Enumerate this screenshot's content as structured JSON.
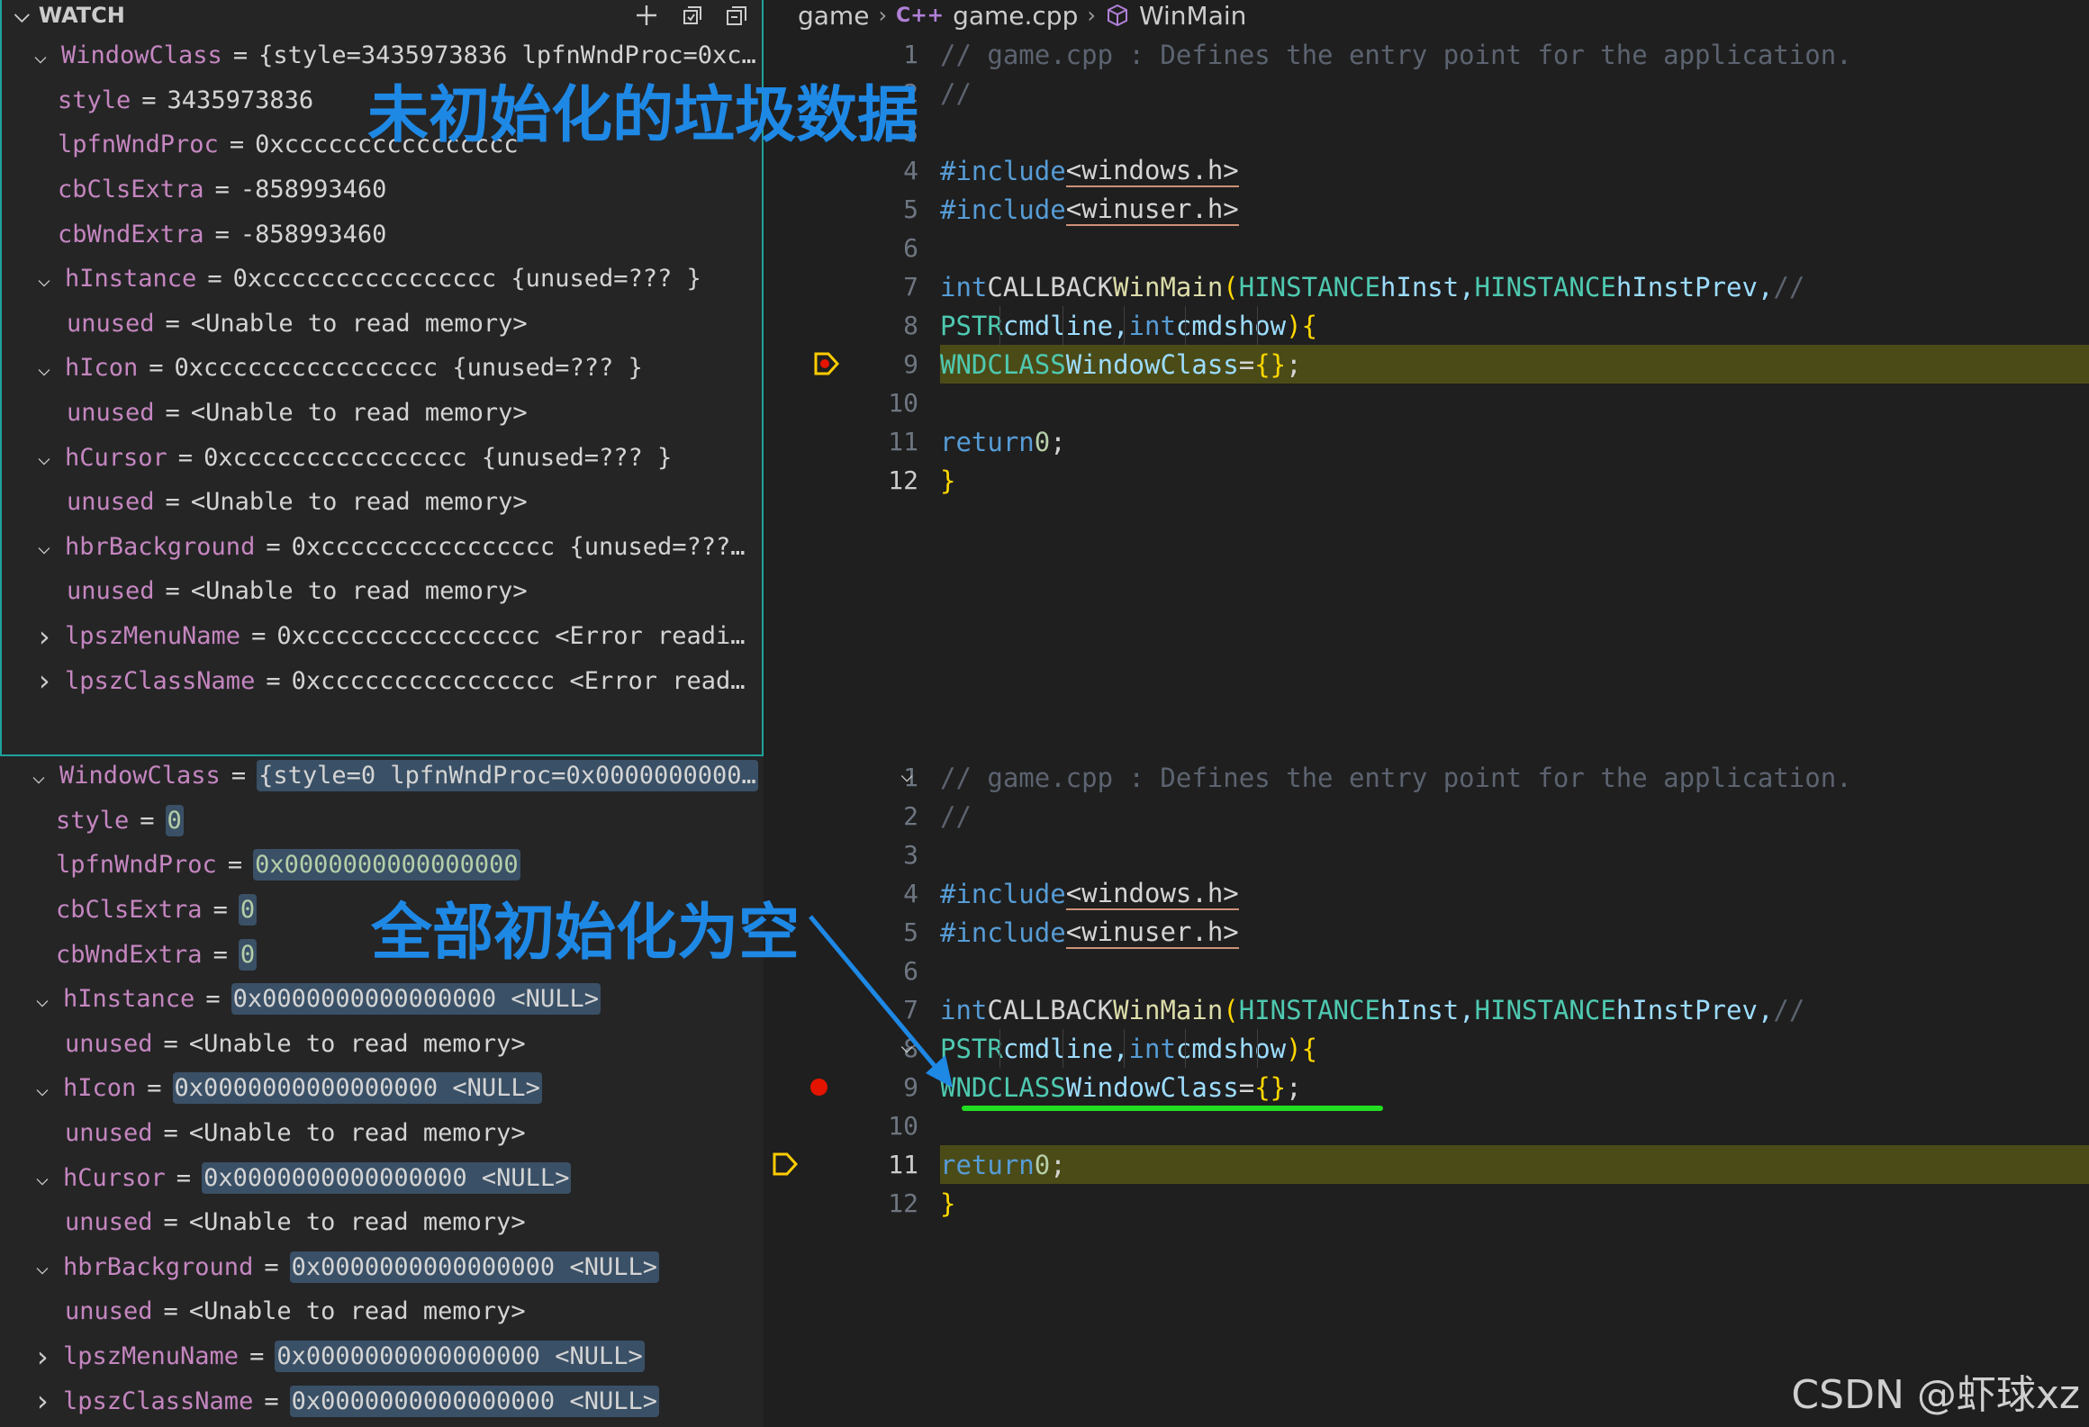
{
  "watch_header": {
    "title": "WATCH"
  },
  "breadcrumb": {
    "folder": "game",
    "lang_icon": "C++",
    "file": "game.cpp",
    "symbol": "WinMain"
  },
  "top": {
    "annotation": "未初始化的垃圾数据",
    "watch_rows": [
      {
        "twisty": "expanded",
        "name": "WindowClass",
        "value": "{style=3435973836 lpfnWndProc=0xc…",
        "value_kind": "text",
        "highlight": false
      },
      {
        "twisty": "none",
        "name": "style",
        "value": "3435973836",
        "value_kind": "text",
        "highlight": false
      },
      {
        "twisty": "none",
        "name": "lpfnWndProc",
        "value": "0xcccccccccccccccc",
        "value_kind": "text",
        "highlight": false
      },
      {
        "twisty": "none",
        "name": "cbClsExtra",
        "value": "-858993460",
        "value_kind": "text",
        "highlight": false
      },
      {
        "twisty": "none",
        "name": "cbWndExtra",
        "value": "-858993460",
        "value_kind": "text",
        "highlight": false
      },
      {
        "twisty": "expanded",
        "name": "hInstance",
        "value": "0xcccccccccccccccc {unused=??? }",
        "value_kind": "text",
        "highlight": false
      },
      {
        "twisty": "none",
        "name": "unused",
        "value": "<Unable to read memory>",
        "value_kind": "text",
        "highlight": false
      },
      {
        "twisty": "expanded",
        "name": "hIcon",
        "value": "0xcccccccccccccccc {unused=??? }",
        "value_kind": "text",
        "highlight": false
      },
      {
        "twisty": "none",
        "name": "unused",
        "value": "<Unable to read memory>",
        "value_kind": "text",
        "highlight": false
      },
      {
        "twisty": "expanded",
        "name": "hCursor",
        "value": "0xcccccccccccccccc {unused=??? }",
        "value_kind": "text",
        "highlight": false
      },
      {
        "twisty": "none",
        "name": "unused",
        "value": "<Unable to read memory>",
        "value_kind": "text",
        "highlight": false
      },
      {
        "twisty": "expanded",
        "name": "hbrBackground",
        "value": "0xcccccccccccccccc {unused=???…",
        "value_kind": "text",
        "highlight": false
      },
      {
        "twisty": "none",
        "name": "unused",
        "value": "<Unable to read memory>",
        "value_kind": "text",
        "highlight": false
      },
      {
        "twisty": "collapsed",
        "name": "lpszMenuName",
        "value": "0xcccccccccccccccc <Error readi…",
        "value_kind": "text",
        "highlight": false
      },
      {
        "twisty": "collapsed",
        "name": "lpszClassName",
        "value": "0xcccccccccccccccc <Error read…",
        "value_kind": "text",
        "highlight": false
      }
    ],
    "line_numbers": [
      "1",
      "2",
      "3",
      "4",
      "5",
      "6",
      "7",
      "8",
      "9",
      "10",
      "11",
      "12"
    ],
    "active_line": "12",
    "current_line": "9",
    "current_marker": "paused-breakpoint-arrow"
  },
  "bottom": {
    "annotation": "全部初始化为空",
    "watch_rows": [
      {
        "twisty": "expanded",
        "name": "WindowClass",
        "value": "{style=0 lpfnWndProc=0x0000000000…",
        "value_kind": "text",
        "highlight": true
      },
      {
        "twisty": "none",
        "name": "style",
        "value": "0",
        "value_kind": "num",
        "highlight": true
      },
      {
        "twisty": "none",
        "name": "lpfnWndProc",
        "value": "0x0000000000000000",
        "value_kind": "num",
        "highlight": true
      },
      {
        "twisty": "none",
        "name": "cbClsExtra",
        "value": "0",
        "value_kind": "num",
        "highlight": true
      },
      {
        "twisty": "none",
        "name": "cbWndExtra",
        "value": "0",
        "value_kind": "num",
        "highlight": true
      },
      {
        "twisty": "expanded",
        "name": "hInstance",
        "value": "0x0000000000000000 <NULL>",
        "value_kind": "text",
        "highlight": true
      },
      {
        "twisty": "none",
        "name": "unused",
        "value": "<Unable to read memory>",
        "value_kind": "text",
        "highlight": false
      },
      {
        "twisty": "expanded",
        "name": "hIcon",
        "value": "0x0000000000000000 <NULL>",
        "value_kind": "text",
        "highlight": true
      },
      {
        "twisty": "none",
        "name": "unused",
        "value": "<Unable to read memory>",
        "value_kind": "text",
        "highlight": false
      },
      {
        "twisty": "expanded",
        "name": "hCursor",
        "value": "0x0000000000000000 <NULL>",
        "value_kind": "text",
        "highlight": true
      },
      {
        "twisty": "none",
        "name": "unused",
        "value": "<Unable to read memory>",
        "value_kind": "text",
        "highlight": false
      },
      {
        "twisty": "expanded",
        "name": "hbrBackground",
        "value": "0x0000000000000000 <NULL>",
        "value_kind": "text",
        "highlight": true
      },
      {
        "twisty": "none",
        "name": "unused",
        "value": "<Unable to read memory>",
        "value_kind": "text",
        "highlight": false
      },
      {
        "twisty": "collapsed",
        "name": "lpszMenuName",
        "value": "0x0000000000000000 <NULL>",
        "value_kind": "text",
        "highlight": true
      },
      {
        "twisty": "collapsed",
        "name": "lpszClassName",
        "value": "0x0000000000000000 <NULL>",
        "value_kind": "text",
        "highlight": true
      }
    ],
    "line_numbers": [
      "1",
      "2",
      "3",
      "4",
      "5",
      "6",
      "7",
      "8",
      "9",
      "10",
      "11",
      "12"
    ],
    "active_line": "11",
    "breakpoint_line": "9",
    "current_line": "11",
    "current_marker": "paused-arrow"
  },
  "code": {
    "l1": "// game.cpp : Defines the entry point for the application.",
    "l2": "//",
    "include_kw": "#include",
    "h1": "<windows.h>",
    "h2": "<winuser.h>",
    "int_kw": "int",
    "callback": "CALLBACK",
    "winmain": "WinMain",
    "paren_open": "(",
    "hinstance_t": "HINSTANCE",
    "hinst": "hInst,",
    "hinstprev": "hInstPrev,",
    "trail_comment": "//",
    "pstr_t": "PSTR",
    "cmdline": "cmdline,",
    "cmdshow": "cmdshow",
    "paren_close": ")",
    "brace_open": "{",
    "wndclass_t": "WNDCLASS",
    "windowclass": "WindowClass",
    "assign": "=",
    "init_braces": "{}",
    "semi": ";",
    "return_kw": "return",
    "zero": "0",
    "brace_close": "}"
  },
  "watermark": "CSDN @虾球xz",
  "colors": {
    "annotation_blue": "#1e88e5",
    "underline_green": "#22dd22",
    "current_line_band": "#4b4b18",
    "watch_border_teal": "#1ea19b",
    "breakpoint_red": "#e51400",
    "paused_arrow_yellow": "#ffcc00"
  }
}
